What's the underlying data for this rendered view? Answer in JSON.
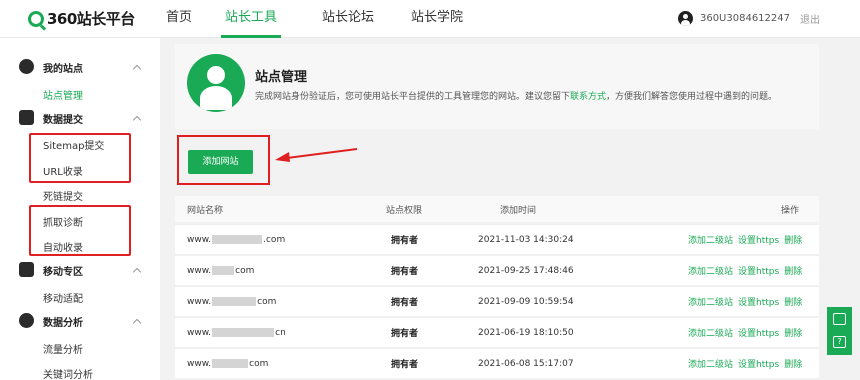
{
  "header": {
    "logo_text": "360站长平台",
    "nav": [
      "首页",
      "站长工具",
      "站长论坛",
      "站长学院"
    ],
    "active_nav": "站长工具",
    "username": "360U3084612247",
    "logout": "退出"
  },
  "sidebar": {
    "groups": [
      {
        "title": "我的站点",
        "icon": "user-icon",
        "items": [
          "站点管理"
        ]
      },
      {
        "title": "数据提交",
        "icon": "chart-icon",
        "items": [
          "Sitemap提交",
          "URL收录",
          "死链提交",
          "抓取诊断",
          "自动收录"
        ]
      },
      {
        "title": "移动专区",
        "icon": "mobile-icon",
        "items": [
          "移动适配"
        ]
      },
      {
        "title": "数据分析",
        "icon": "analysis-icon",
        "items": [
          "流量分析",
          "关键词分析"
        ]
      }
    ],
    "active_item": "站点管理"
  },
  "main": {
    "title": "站点管理",
    "desc_before": "完成网站身份验证后，您可使用站长平台提供的工具管理您的网站。建议您留下",
    "desc_link": "联系方式",
    "desc_after": "，方便我们解答您使用过程中遇到的问题。",
    "add_button": "添加网站",
    "columns": [
      "网站名称",
      "站点权限",
      "添加时间",
      "操作"
    ],
    "rows": [
      {
        "prefix": "www.",
        "suffix": ".com",
        "role": "拥有者",
        "time": "2021-11-03 14:30:24"
      },
      {
        "prefix": "www.",
        "suffix": "com",
        "role": "拥有者",
        "time": "2021-09-25 17:48:46"
      },
      {
        "prefix": "www.",
        "suffix": "com",
        "role": "拥有者",
        "time": "2021-09-09 10:59:54"
      },
      {
        "prefix": "www.",
        "suffix": "cn",
        "role": "拥有者",
        "time": "2021-06-19 18:10:50"
      },
      {
        "prefix": "www.",
        "suffix": "com",
        "role": "拥有者",
        "time": "2021-06-08 15:17:07"
      }
    ],
    "actions": [
      "添加二级站",
      "设置https",
      "删除"
    ]
  },
  "colors": {
    "brand": "#1aaa55",
    "highlight": "#e02020"
  },
  "float_icons": [
    "edit-icon",
    "help-icon"
  ],
  "float_help_glyph": "?"
}
